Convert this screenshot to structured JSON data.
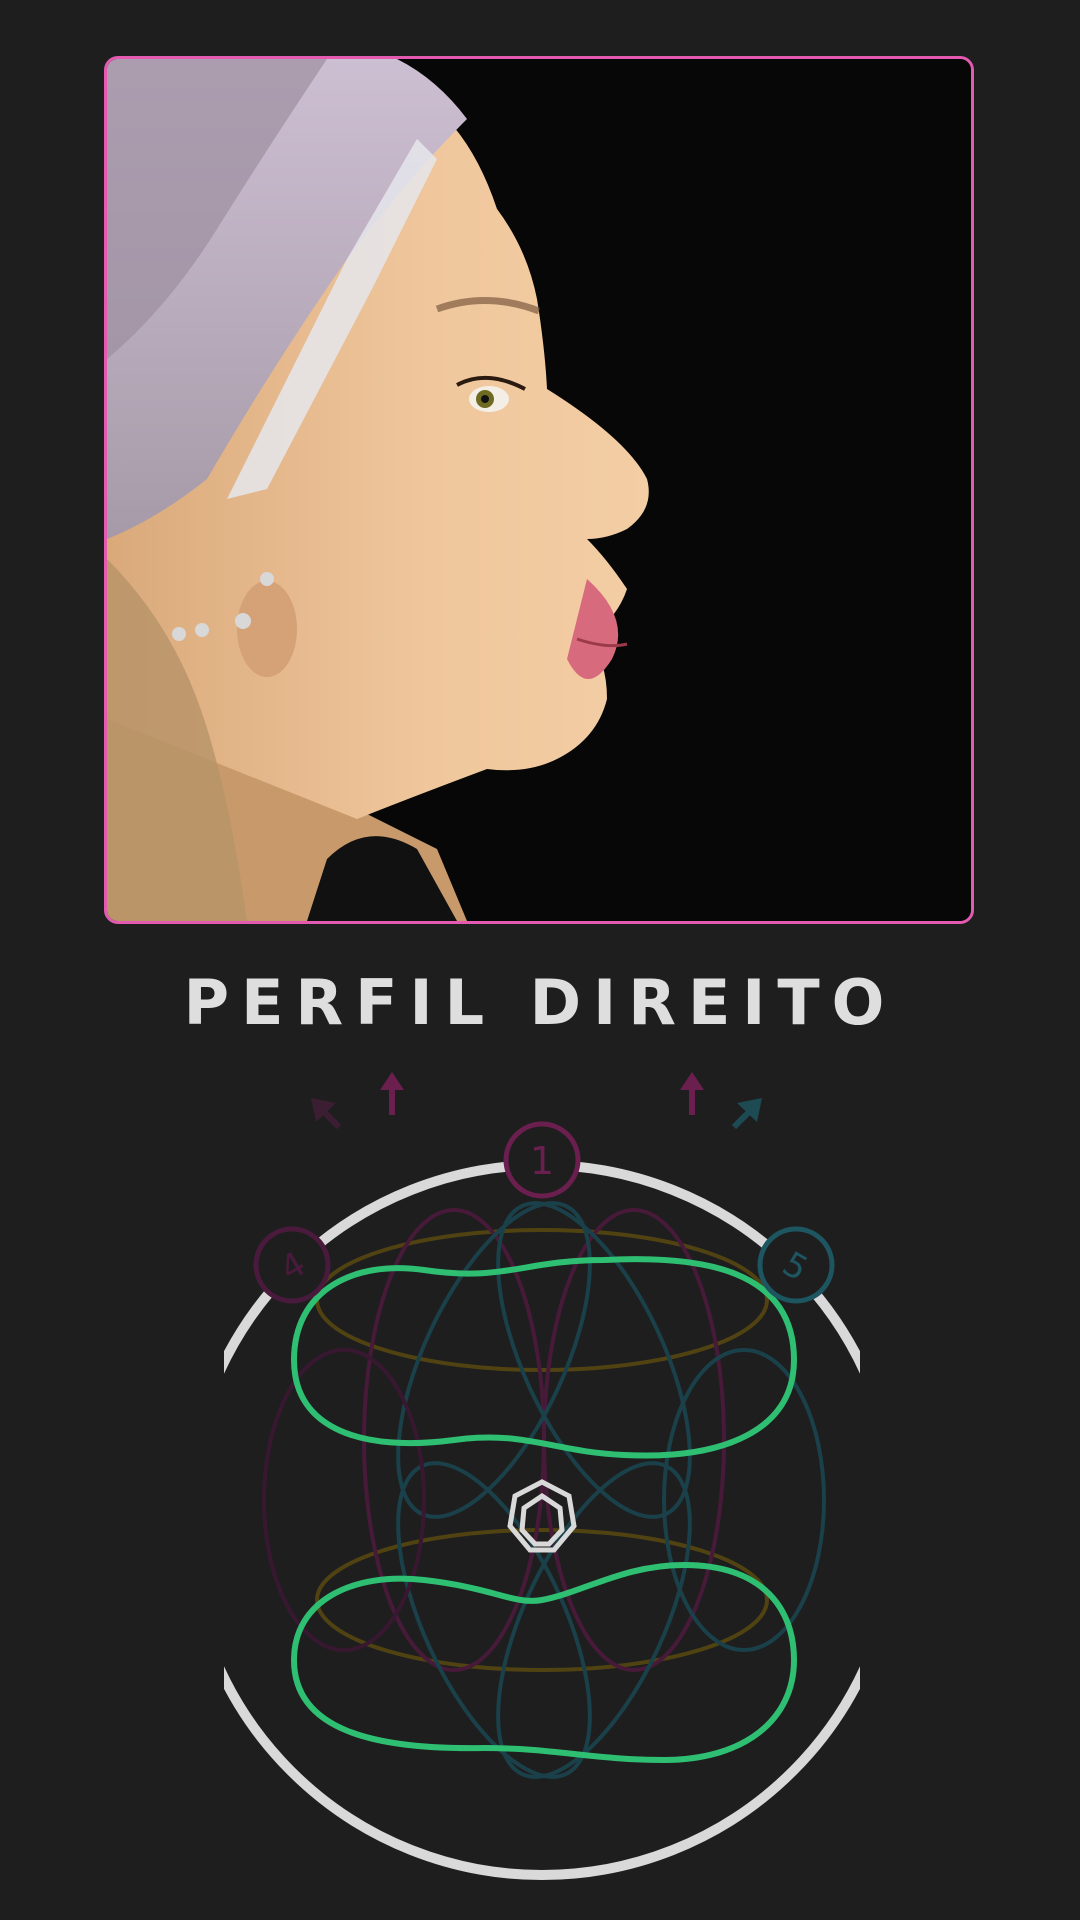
{
  "title": "PERFIL DIREITO",
  "photo": {
    "icon": "face-profile-photo",
    "frame_color": "#e35ab0"
  },
  "diagram": {
    "nodes": [
      {
        "label": "1",
        "color": "#9c2a6a"
      },
      {
        "label": "4",
        "color": "#7a2458"
      },
      {
        "label": "5",
        "color": "#1f6f72"
      }
    ],
    "colors": {
      "ring": "#d9d9d9",
      "primary_loops": "#2fbf72",
      "gold": "#7a6410",
      "magenta": "#6b1f4e",
      "teal": "#1d5560"
    }
  }
}
